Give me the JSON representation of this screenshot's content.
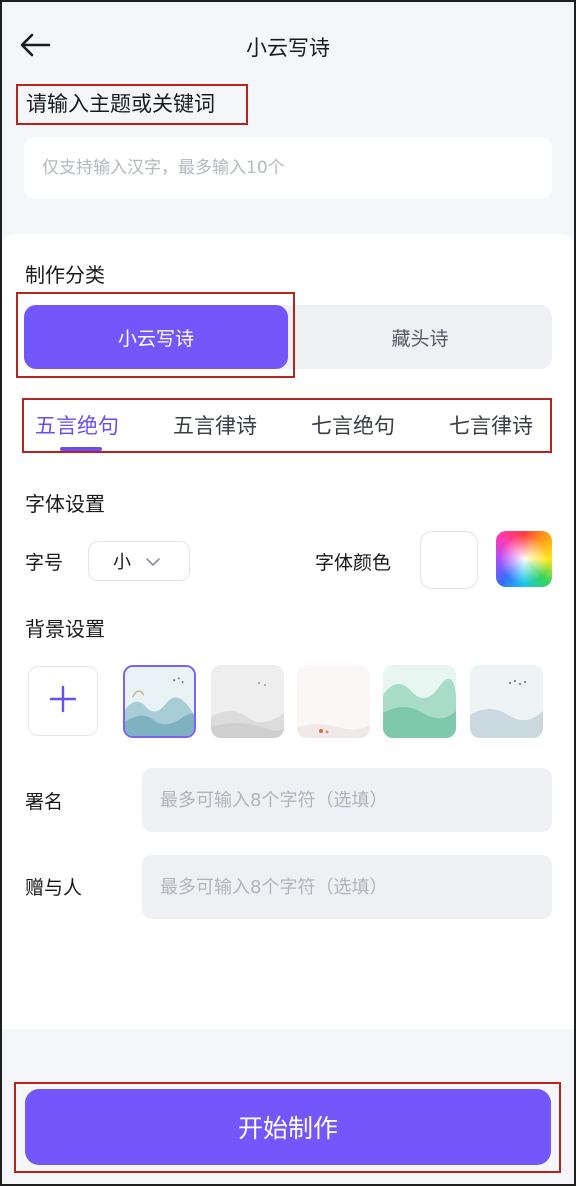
{
  "header": {
    "title": "小云写诗",
    "back_icon": "arrow-left-icon"
  },
  "keyword": {
    "label": "请输入主题或关键词",
    "placeholder": "仅支持输入汉字，最多输入10个",
    "value": ""
  },
  "category": {
    "label": "制作分类",
    "options": [
      "小云写诗",
      "藏头诗"
    ],
    "selected": "小云写诗"
  },
  "poem_tabs": {
    "items": [
      "五言绝句",
      "五言律诗",
      "七言绝句",
      "七言律诗"
    ],
    "selected": "五言绝句"
  },
  "font_settings": {
    "label": "字体设置",
    "size_label": "字号",
    "size_value": "小",
    "color_label": "字体颜色",
    "color_value": "#ffffff"
  },
  "background_settings": {
    "label": "背景设置",
    "add_icon": "plus-icon",
    "selected_index": 0,
    "thumbnail_count": 5
  },
  "signature": {
    "label": "署名",
    "placeholder": "最多可输入8个字符（选填）",
    "value": ""
  },
  "recipient": {
    "label": "赠与人",
    "placeholder": "最多可输入8个字符（选填）",
    "value": ""
  },
  "footer": {
    "start_label": "开始制作"
  },
  "colors": {
    "accent": "#7357fb",
    "highlight_box": "#b3261e",
    "page_bg": "#f4f6f9",
    "field_bg": "#eef0f4"
  }
}
